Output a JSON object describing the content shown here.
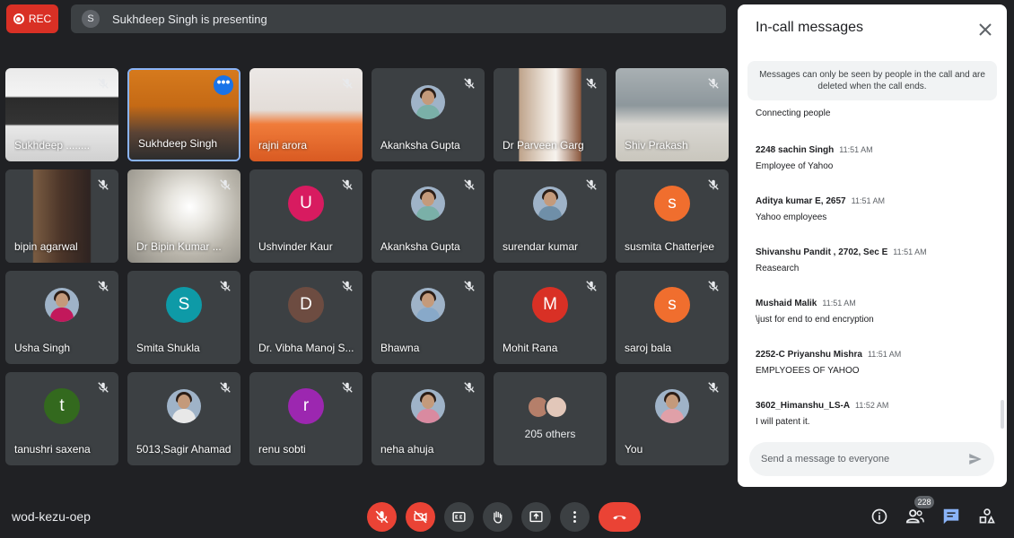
{
  "recording": {
    "label": "REC"
  },
  "presentation": {
    "avatar_letter": "S",
    "text": "Sukhdeep Singh is presenting"
  },
  "participants": [
    {
      "name": "Sukhdeep ........",
      "kind": "screen"
    },
    {
      "name": "Sukhdeep Singh",
      "kind": "video",
      "active": true
    },
    {
      "name": "rajni arora",
      "kind": "video"
    },
    {
      "name": "Akanksha Gupta",
      "kind": "photo",
      "color": "#7ab0a8"
    },
    {
      "name": "Dr Parveen Garg",
      "kind": "video"
    },
    {
      "name": "Shiv Prakash",
      "kind": "video"
    },
    {
      "name": "bipin agarwal",
      "kind": "video"
    },
    {
      "name": "Dr Bipin Kumar ...",
      "kind": "video"
    },
    {
      "name": "Ushvinder Kaur",
      "kind": "letter",
      "letter": "U",
      "color": "#d81b60"
    },
    {
      "name": "Akanksha Gupta",
      "kind": "photo",
      "color": "#7ab0a8"
    },
    {
      "name": "surendar kumar",
      "kind": "photo",
      "color": "#6f8fa8"
    },
    {
      "name": "susmita Chatterjee",
      "kind": "letter",
      "letter": "s",
      "color": "#f06e2e"
    },
    {
      "name": "Usha Singh",
      "kind": "photo",
      "color": "#c2185b"
    },
    {
      "name": "Smita Shukla",
      "kind": "letter",
      "letter": "S",
      "color": "#0e9aa7"
    },
    {
      "name": "Dr. Vibha Manoj S...",
      "kind": "letter",
      "letter": "D",
      "color": "#6d4c41"
    },
    {
      "name": "Bhawna",
      "kind": "photo",
      "color": "#88a9c9"
    },
    {
      "name": "Mohit Rana",
      "kind": "letter",
      "letter": "M",
      "color": "#d93025"
    },
    {
      "name": "saroj bala",
      "kind": "letter",
      "letter": "s",
      "color": "#f06e2e"
    },
    {
      "name": "tanushri saxena",
      "kind": "letter",
      "letter": "t",
      "color": "#33691e"
    },
    {
      "name": "5013,Sagir Ahamad",
      "kind": "photo",
      "color": "#e8e8e8"
    },
    {
      "name": "renu sobti",
      "kind": "letter",
      "letter": "r",
      "color": "#9c27b0"
    },
    {
      "name": "neha ahuja",
      "kind": "photo",
      "color": "#d98aa0"
    },
    {
      "name": "205 others",
      "kind": "others"
    },
    {
      "name": "You",
      "kind": "photo",
      "color": "#e0a0a8"
    }
  ],
  "chat": {
    "title": "In-call messages",
    "notice": "Messages can only be seen by people in the call and are deleted when the call ends.",
    "status": "Connecting people",
    "messages": [
      {
        "sender": "2248 sachin Singh",
        "time": "11:51 AM",
        "text": "Employee of Yahoo"
      },
      {
        "sender": "Aditya kumar E, 2657",
        "time": "11:51 AM",
        "text": "Yahoo employees"
      },
      {
        "sender": "Shivanshu Pandit , 2702, Sec E",
        "time": "11:51 AM",
        "text": "Reasearch"
      },
      {
        "sender": "Mushaid Malik",
        "time": "11:51 AM",
        "text": "\\just for end to end  encryption"
      },
      {
        "sender": "2252-C Priyanshu Mishra",
        "time": "11:51 AM",
        "text": "EMPLYOEES OF YAHOO"
      },
      {
        "sender": "3602_Himanshu_LS-A",
        "time": "11:52 AM",
        "text": "I will patent it."
      }
    ],
    "input_placeholder": "Send a message to everyone"
  },
  "meeting": {
    "code": "wod-kezu-oep",
    "people_count": "228"
  },
  "controls": [
    {
      "name": "mic-off-button",
      "icon": "mic-off-icon",
      "red": true
    },
    {
      "name": "camera-off-button",
      "icon": "camera-off-icon",
      "red": true
    },
    {
      "name": "captions-button",
      "icon": "captions-icon",
      "red": false
    },
    {
      "name": "raise-hand-button",
      "icon": "hand-icon",
      "red": false
    },
    {
      "name": "present-screen-button",
      "icon": "present-icon",
      "red": false
    },
    {
      "name": "more-options-button",
      "icon": "more-vert-icon",
      "red": false
    },
    {
      "name": "hang-up-button",
      "icon": "hang-up-icon",
      "red": true
    }
  ],
  "colors": {
    "background": "#202124",
    "tile": "#3c4043",
    "accent": "#1a73e8",
    "danger": "#ea4335"
  }
}
